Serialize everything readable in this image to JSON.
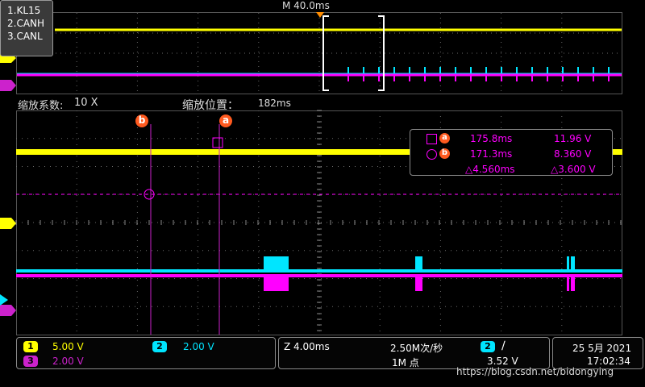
{
  "colors": {
    "ch1": "#ffff00",
    "ch2": "#00e5ff",
    "ch3": "#ff00ff",
    "marker": "#ff5a1f",
    "grid": "#6a6a6a"
  },
  "channel_legend": [
    "1.KL15",
    "2.CANH",
    "3.CANL"
  ],
  "overview": {
    "time_label": "M 40.0ms"
  },
  "zoom": {
    "factor_label": "缩放系数:",
    "factor_value": "10 X",
    "position_label": "缩放位置：",
    "position_value": "182ms"
  },
  "channel_markers": {
    "ch1": "1",
    "ch3": "3"
  },
  "cursor_labels": {
    "a": "a",
    "b": "b"
  },
  "measurements": {
    "a_time": "175.8ms",
    "a_value": "11.96 V",
    "b_time": "171.3ms",
    "b_value": "8.360 V",
    "delta_time": "△4.560ms",
    "delta_value": "△3.600 V"
  },
  "bottom": {
    "ch1_num": "1",
    "ch1_scale": "5.00 V",
    "ch2_num": "2",
    "ch2_scale": "2.00 V",
    "ch3_num": "3",
    "ch3_scale": "2.00 V",
    "zoom_time": "Z 4.00ms",
    "sample_rate": "2.50M次/秒",
    "record_length": "1M 点",
    "trig_channel": "2",
    "trig_slope": "∕",
    "trig_level": "3.52 V",
    "date": "25 5月 2021",
    "time": "17:02:34"
  },
  "watermark": "https://blog.csdn.net/bidongying"
}
